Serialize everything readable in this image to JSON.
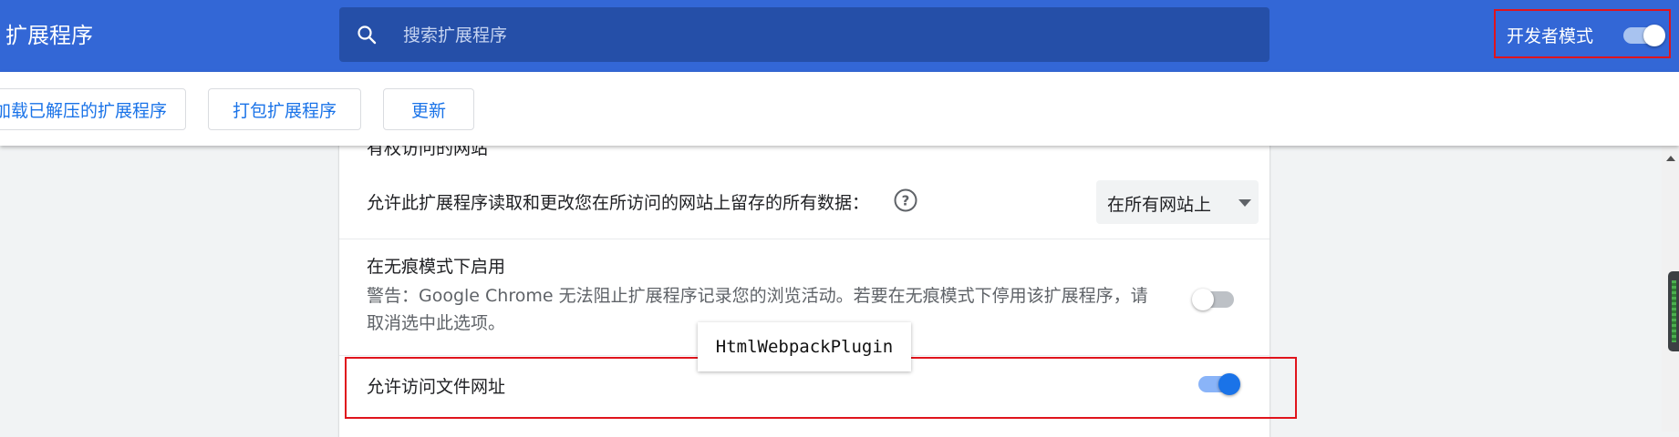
{
  "header": {
    "title": "扩展程序",
    "search_placeholder": "搜索扩展程序",
    "dev_mode_label": "开发者模式",
    "dev_mode_on": true
  },
  "toolbar": {
    "load_unpacked_label": "加载已解压的扩展程序",
    "pack_label": "打包扩展程序",
    "update_label": "更新"
  },
  "details": {
    "site_access_heading": "有权访问的网站",
    "site_access_desc": "允许此扩展程序读取和更改您在所访问的网站上留存的所有数据：",
    "site_access_value": "在所有网站上",
    "incognito_title": "在无痕模式下启用",
    "incognito_warning": "警告：Google Chrome 无法阻止扩展程序记录您的浏览活动。若要在无痕模式下停用该扩展程序，请取消选中此选项。",
    "incognito_enabled": false,
    "file_urls_label": "允许访问文件网址",
    "file_urls_enabled": true
  },
  "tooltip": {
    "text": "HtmlWebpackPlugin"
  },
  "colors": {
    "header_bg": "#3367d6",
    "search_bg": "#254fa8",
    "accent": "#1a73e8",
    "highlight_red": "#e0141c"
  },
  "icons": {
    "search": "search-icon",
    "help": "help-circle-icon",
    "dropdown": "arrow-drop-down-icon"
  }
}
